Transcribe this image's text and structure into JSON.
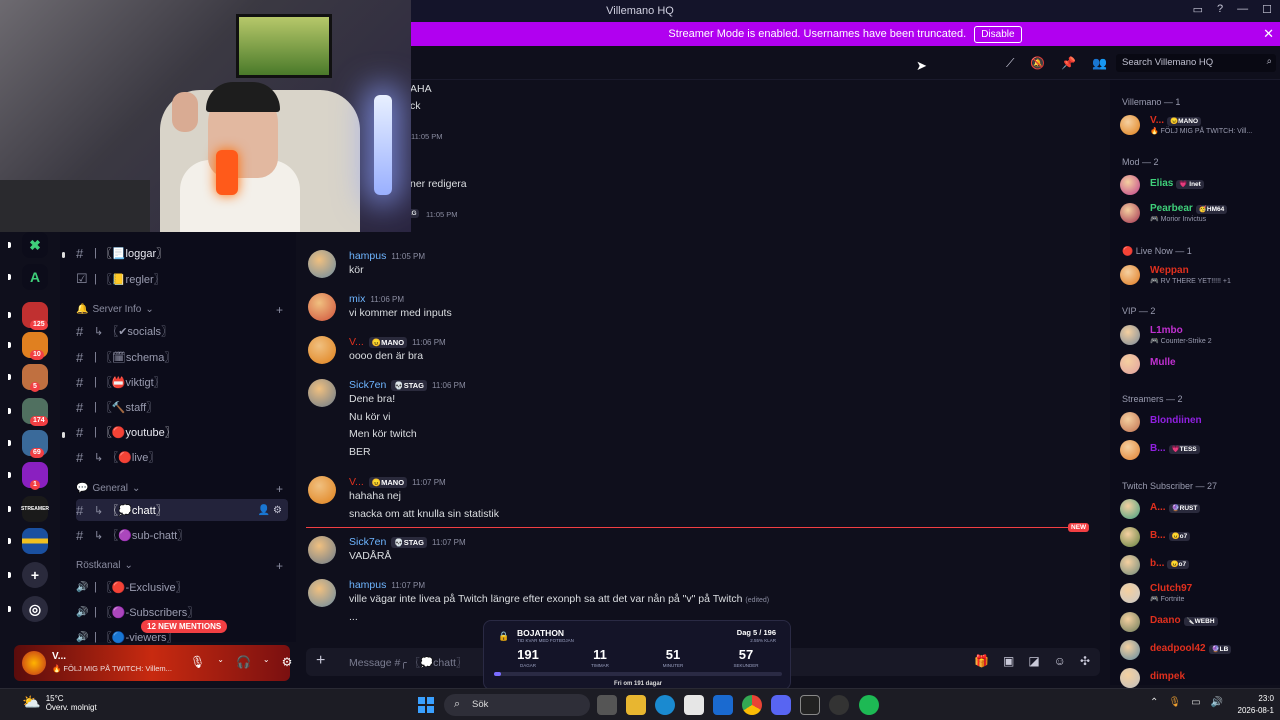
{
  "window": {
    "title": "Villemano HQ"
  },
  "streamer_bar": {
    "text": "Streamer Mode is enabled. Usernames have been truncated.",
    "button": "Disable"
  },
  "servers": {
    "badges": [
      "125",
      "10",
      "5",
      "174",
      "69",
      "1"
    ],
    "icons": [
      "x-server-icon",
      "a-server-icon",
      "server-125",
      "server-10",
      "server-5",
      "server-174",
      "server-69",
      "server-1",
      "streamer-server-icon",
      "sweden-server-icon",
      "add-server-icon",
      "discover-icon"
    ],
    "streamer_label": "STREAMER"
  },
  "channels": {
    "items": [
      {
        "type": "text",
        "name": "〖📃loggar〗"
      },
      {
        "type": "rules",
        "name": "〖📒regler〗"
      },
      {
        "type": "category",
        "name": "Server Info"
      },
      {
        "type": "thread",
        "name": "〖✔socials〗"
      },
      {
        "type": "text",
        "name": "〖🗓schema〗"
      },
      {
        "type": "text",
        "name": "〖📛viktigt〗"
      },
      {
        "type": "text",
        "name": "〖🔨staff〗"
      },
      {
        "type": "text",
        "name": "〖🔴youtube〗"
      },
      {
        "type": "thread",
        "name": "〖🔴live〗"
      },
      {
        "type": "category",
        "name": "General"
      },
      {
        "type": "thread",
        "name": "〖💭chatt〗"
      },
      {
        "type": "thread",
        "name": "〖🟣sub-chatt〗"
      },
      {
        "type": "category",
        "name": "Röstkanal"
      },
      {
        "type": "voice",
        "name": "〖🔴-Exclusive〗"
      },
      {
        "type": "voice",
        "name": "〖🟣-Subscribers〗"
      },
      {
        "type": "voice",
        "name": "〖🔵-viewers〗"
      }
    ],
    "new_mentions": "12 NEW MENTIONS"
  },
  "user_panel": {
    "name": "V...",
    "status": "🔥 FÖLJ MIG PÅ TWITCH: Villem..."
  },
  "header": {
    "search_placeholder": "Search Villemano HQ"
  },
  "partial_messages": {
    "line1": "AHA",
    "line2": "ck",
    "time1": "11:05 PM",
    "line3": "ner redigera",
    "tag": "STAG",
    "time2": "11:05 PM"
  },
  "messages": [
    {
      "author": "hampus",
      "color": "#6eb5ff",
      "tag": "",
      "time": "11:05 PM",
      "lines": [
        "kör"
      ]
    },
    {
      "author": "mix",
      "color": "#6eb5ff",
      "tag": "",
      "time": "11:06 PM",
      "lines": [
        "vi kommer med inputs"
      ]
    },
    {
      "author": "V...",
      "color": "#e0301e",
      "tag": "😠MANO",
      "time": "11:06 PM",
      "lines": [
        "oooo den är bra"
      ]
    },
    {
      "author": "Sick7en",
      "color": "#6eb5ff",
      "tag": "💀STAG",
      "time": "11:06 PM",
      "lines": [
        "Dene bra!",
        "Nu kör vi",
        "Men kör twitch",
        "BER"
      ]
    },
    {
      "author": "V...",
      "color": "#e0301e",
      "tag": "😠MANO",
      "time": "11:07 PM",
      "lines": [
        "hahaha nej",
        "snacka om att knulla sin statistik"
      ]
    },
    {
      "author": "Sick7en",
      "color": "#6eb5ff",
      "tag": "💀STAG",
      "time": "11:07 PM",
      "lines": [
        "VADÅRÅ"
      ]
    },
    {
      "author": "hampus",
      "color": "#6eb5ff",
      "tag": "",
      "time": "11:07 PM",
      "lines": [
        "ville vägar inte livea på Twitch längre efter exonph sa att det var nån på \"v\" på Twitch",
        "..."
      ],
      "edited": "(edited)"
    }
  ],
  "new_marker": "NEW",
  "composer": {
    "placeholder": "Message #╭ 〖💭chatt〗"
  },
  "bojathon": {
    "title": "BOJATHON",
    "subtitle": "TID KVAR MED FOTBOJAN",
    "day": "Dag 5 / 196",
    "day_sub": "2.55% KLAR",
    "countdown": [
      {
        "value": "191",
        "unit": "DAGAR"
      },
      {
        "value": "11",
        "unit": "TIMMAR"
      },
      {
        "value": "51",
        "unit": "MINUTER"
      },
      {
        "value": "57",
        "unit": "SEKUNDER"
      }
    ],
    "progress": 0.0255,
    "footer": "Fri om 191 dagar"
  },
  "members": {
    "groups": [
      {
        "label": "Villemano — 1",
        "members": [
          {
            "name": "V...",
            "color": "#e0301e",
            "tag": "😠MANO",
            "activity": "🔥 FÖLJ MIG PÅ TWITCH: Vill..."
          }
        ]
      },
      {
        "label": "Mod — 2",
        "members": [
          {
            "name": "Elias",
            "color": "#3fd07a",
            "tag": "💗 Inet",
            "activity": ""
          },
          {
            "name": "Pearbear",
            "color": "#3fd07a",
            "tag": "🥳HM64",
            "activity": "🎮 Morior Invictus"
          }
        ]
      },
      {
        "label": "🔴 Live Now — 1",
        "members": [
          {
            "name": "Weppan",
            "color": "#e0301e",
            "tag": "",
            "activity": "🎮 RV THERE YET!!!!! +1"
          }
        ]
      },
      {
        "label": "VIP — 2",
        "members": [
          {
            "name": "L1mbo",
            "color": "#c030d0",
            "tag": "",
            "activity": "🎮 Counter-Strike 2"
          },
          {
            "name": "Mulle",
            "color": "#c030d0",
            "tag": "",
            "activity": ""
          }
        ]
      },
      {
        "label": "Streamers — 2",
        "members": [
          {
            "name": "Blondiinen",
            "color": "#9020e0",
            "tag": "",
            "activity": ""
          },
          {
            "name": "B...",
            "color": "#9020e0",
            "tag": "💗TESS",
            "activity": ""
          }
        ]
      },
      {
        "label": "Twitch Subscriber — 27",
        "members": [
          {
            "name": "A...",
            "color": "#e0301e",
            "tag": "🔮RUST",
            "activity": ""
          },
          {
            "name": "B...",
            "color": "#e0301e",
            "tag": "😠o7",
            "activity": ""
          },
          {
            "name": "b...",
            "color": "#e0301e",
            "tag": "😠o7",
            "activity": ""
          },
          {
            "name": "Clutch97",
            "color": "#e0301e",
            "tag": "",
            "activity": "🎮 Fortnite"
          },
          {
            "name": "Daano",
            "color": "#e0301e",
            "tag": "🔪WEBH",
            "activity": ""
          },
          {
            "name": "deadpool42",
            "color": "#e0301e",
            "tag": "🔮LB",
            "activity": ""
          },
          {
            "name": "dimpek",
            "color": "#e0301e",
            "tag": "",
            "activity": ""
          }
        ]
      }
    ]
  },
  "taskbar": {
    "weather_temp": "15°C",
    "weather_desc": "Överv. molnigt",
    "search": "Sök",
    "time": "23:0",
    "date": "2026-08-1"
  }
}
